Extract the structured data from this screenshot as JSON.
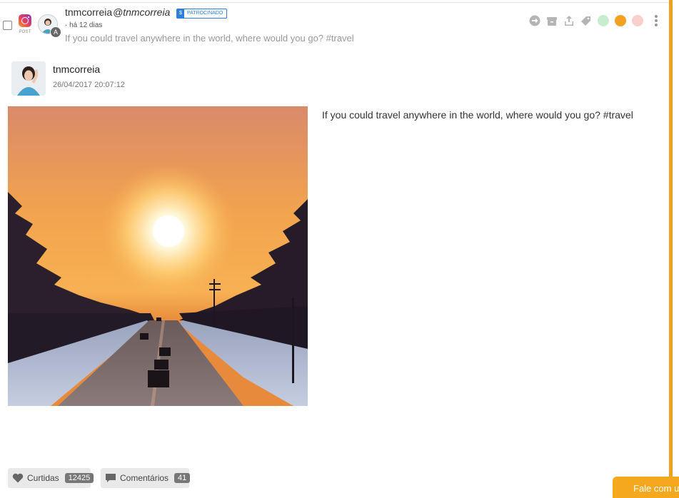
{
  "post": {
    "network": "instagram",
    "type_label": "POST",
    "author_name": "tnmcorreia",
    "author_handle": "@tnmcorreia",
    "sponsor_symbol": "$",
    "sponsor_label": "PATROCINADO",
    "avatar_badge": "A",
    "time_ago": "· há 12 dias",
    "preview_text": "If you could travel anywhere in the world, where would you go? #travel",
    "display_name": "tnmcorreia",
    "date": "26/04/2017 20:07:12",
    "caption": "If you could travel anywhere in the world, where would you go? #travel"
  },
  "actions": {
    "icons": [
      "forward-icon",
      "archive-icon",
      "share-icon",
      "tag-icon",
      "sentiment-positive-icon",
      "sentiment-neutral-icon",
      "sentiment-negative-icon",
      "more-icon"
    ],
    "colors": {
      "positive": "#b9e6c0",
      "neutral": "#f4a020",
      "negative": "#f7c4c4",
      "icon": "#b5b5b5"
    }
  },
  "stats": {
    "likes_label": "Curtidas",
    "likes_count": "12425",
    "comments_label": "Comentários",
    "comments_count": "41"
  },
  "chat": {
    "label": "Fale com um"
  },
  "colors": {
    "accent": "#f0a020",
    "sponsor": "#2f7ed8"
  }
}
